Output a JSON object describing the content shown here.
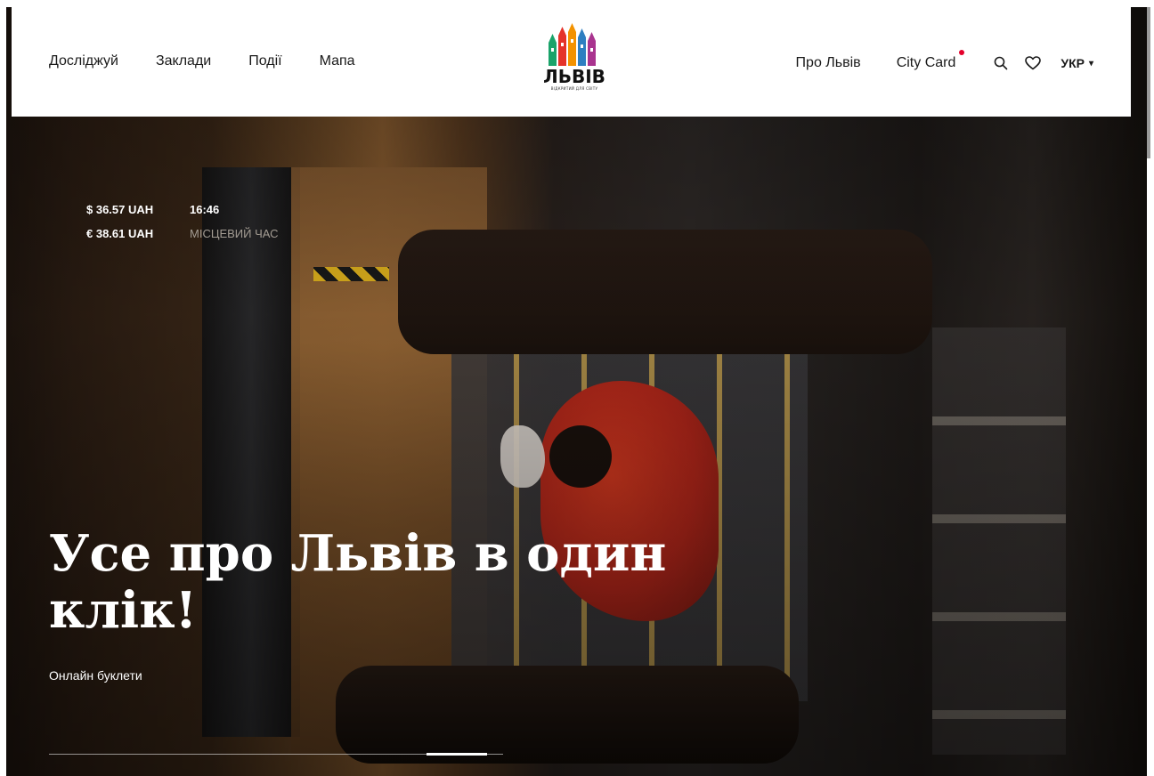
{
  "header": {
    "nav_left": [
      "Досліджуй",
      "Заклади",
      "Події",
      "Мапа"
    ],
    "logo": {
      "word": "ЛЬВІВ",
      "tagline": "ВІДКРИТИЙ ДЛЯ СВІТУ"
    },
    "nav_right": {
      "about": "Про Львів",
      "city_card": "City Card"
    },
    "icons": {
      "search": "search-icon",
      "favorites": "heart-icon"
    },
    "language": {
      "label": "УКР",
      "caret": "▾"
    }
  },
  "info": {
    "usd_rate": "$ 36.57 UAH",
    "eur_rate": "€ 38.61 UAH",
    "time": "16:46",
    "time_label": "МІСЦЕВИЙ ЧАС"
  },
  "hero": {
    "title": "Усе про Львів в один клік!",
    "subtitle": "Онлайн буклети"
  },
  "colors": {
    "accent_dot": "#e4002b",
    "text_dark": "#1a1a1a",
    "muted_label": "#a39c93"
  }
}
